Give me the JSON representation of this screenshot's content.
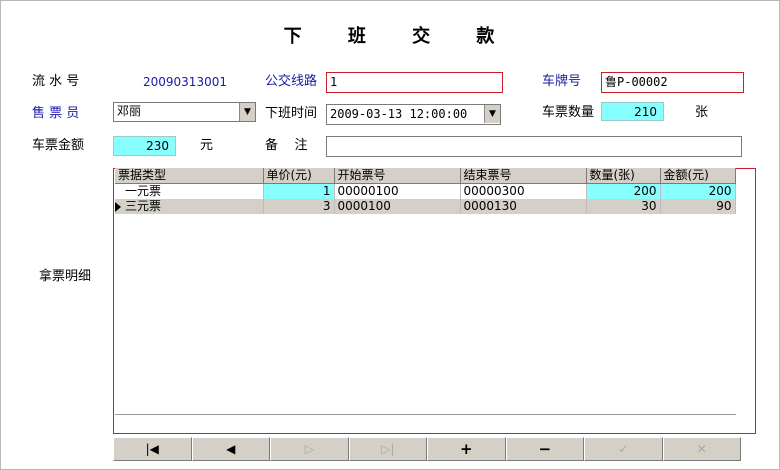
{
  "title": "下 班 交 款",
  "form": {
    "serial_label": "流 水 号",
    "serial_value": "20090313001",
    "route_label": "公交线路",
    "route_value": "1",
    "plate_label": "车牌号",
    "plate_value": "鲁P-00002",
    "seller_label": "售 票 员",
    "seller_value": "邓丽",
    "offtime_label": "下班时间",
    "offtime_value": "2009-03-13 12:00:00",
    "ticket_qty_label": "车票数量",
    "ticket_qty_value": "210",
    "ticket_qty_unit": "张",
    "amount_label": "车票金额",
    "amount_value": "230",
    "amount_unit": "元",
    "remark_label": "备    注",
    "remark_value": ""
  },
  "detail_label": "拿票明细",
  "grid": {
    "headers": [
      "票据类型",
      "单价(元)",
      "开始票号",
      "结束票号",
      "数量(张)",
      "金额(元)"
    ],
    "rows": [
      [
        "一元票",
        "1",
        "00000100",
        "00000300",
        "200",
        "200"
      ],
      [
        "三元票",
        "3",
        "0000100",
        "0000130",
        "30",
        "90"
      ]
    ]
  },
  "nav": [
    {
      "name": "first-record-button",
      "glyph": "|◀"
    },
    {
      "name": "prior-record-button",
      "glyph": "◀"
    },
    {
      "name": "next-record-button",
      "glyph": "▷"
    },
    {
      "name": "last-record-button",
      "glyph": "▷|"
    },
    {
      "name": "insert-record-button",
      "glyph": "+"
    },
    {
      "name": "delete-record-button",
      "glyph": "−"
    },
    {
      "name": "post-record-button",
      "glyph": "✓"
    },
    {
      "name": "cancel-record-button",
      "glyph": "✕"
    }
  ],
  "colors": {
    "accent_cyan": "#88ffff",
    "required_border": "#c8202a",
    "label_blue": "#1a1aa6"
  }
}
